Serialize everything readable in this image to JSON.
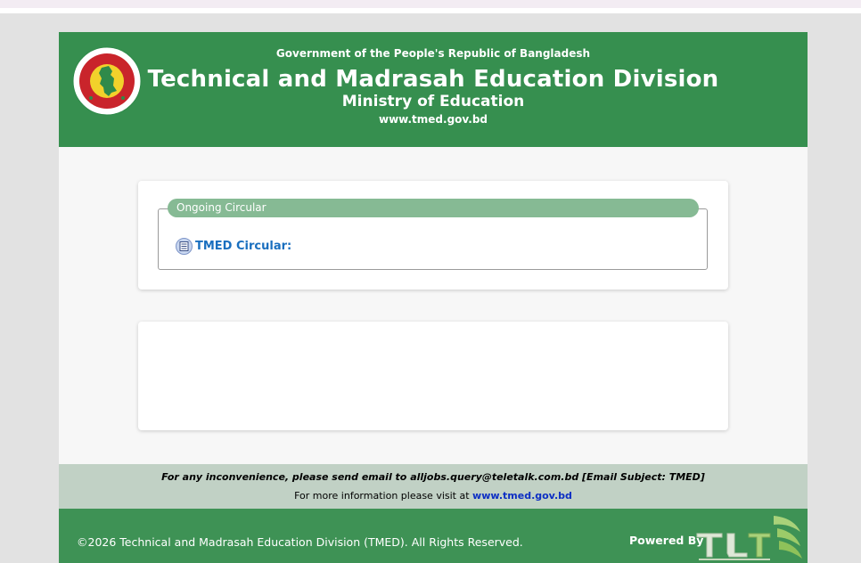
{
  "header": {
    "government": "Government of the People's Republic of Bangladesh",
    "title": "Technical and Madrasah Education Division",
    "ministry": "Ministry of Education",
    "website": "www.tmed.gov.bd",
    "seal_icon": "bangladesh-government-seal"
  },
  "circular": {
    "legend": "Ongoing Circular",
    "link_label": "TMED Circular:",
    "link_icon": "document-icon"
  },
  "notice": {
    "email_text": "For any inconvenience, please send email to alljobs.query@teletalk.com.bd [Email Subject: TMED]",
    "info_prefix": "For more information please visit at",
    "info_link": "www.tmed.gov.bd"
  },
  "footer": {
    "copyright": "©2026 Technical and Madrasah Education Division (TMED). All Rights Reserved.",
    "powered_by": "Powered By",
    "logo_icon": "teletalk-logo"
  },
  "colors": {
    "header_green": "#368f4f",
    "legend_green": "#86ba94",
    "notice_bg": "#c1d1c5",
    "footer_green": "#3e9255",
    "link_blue": "#1a6fbf"
  }
}
